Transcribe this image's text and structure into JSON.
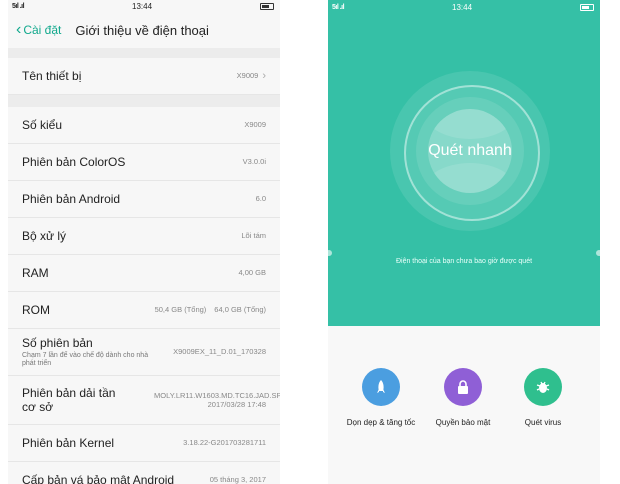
{
  "left": {
    "status_bar": {
      "signal": "5ıl .ıl",
      "time": "13:44"
    },
    "nav": {
      "back_label": "Cài đặt",
      "title": "Giới thiệu về điện thoại"
    },
    "device_name": {
      "label": "Tên thiết bị",
      "value": "X9009"
    },
    "rows": {
      "model": {
        "label": "Số kiểu",
        "value": "X9009"
      },
      "coloros": {
        "label": "Phiên bản ColorOS",
        "value": "V3.0.0i"
      },
      "android": {
        "label": "Phiên bản Android",
        "value": "6.0"
      },
      "cpu": {
        "label": "Bộ xử lý",
        "value": "Lõi tám"
      },
      "ram": {
        "label": "RAM",
        "value": "4,00 GB"
      },
      "rom": {
        "label": "ROM",
        "value1": "50,4 GB (Tổng)",
        "value2": "64,0 GB (Tổng)"
      },
      "build": {
        "label": "Số phiên bản",
        "hint": "Chạm 7 lần để vào chế độ dành cho nhà phát triển",
        "value": "X9009EX_11_D.01_170328"
      },
      "baseband": {
        "label": "Phiên bản dải tần cơ sở",
        "value": "MOLY.LR11.W1603.MD.TC16.JAD.SP.V5.P48, 2017/03/28 17:48"
      },
      "kernel": {
        "label": "Phiên bản Kernel",
        "value": "3.18.22-G201703281711"
      },
      "security": {
        "label": "Cấp bản vá bảo mật Android",
        "value": "05 tháng 3, 2017"
      }
    }
  },
  "right": {
    "status_bar": {
      "signal": "5ıl .ıl",
      "time": "13:44"
    },
    "scan_button": "Quét nhanh",
    "message": "Điện thoại của bạn chưa bao giờ được quét",
    "tools": [
      {
        "label": "Dọn dẹp & tăng tốc",
        "icon": "rocket-icon",
        "color": "#4b9ee0"
      },
      {
        "label": "Quyền bảo mật",
        "icon": "lock-icon",
        "color": "#8f5fd6"
      },
      {
        "label": "Quét virus",
        "icon": "bug-icon",
        "color": "#2fbf8e"
      }
    ]
  },
  "colors": {
    "accent": "#12a98d",
    "scan_green": "#35c0a6"
  }
}
